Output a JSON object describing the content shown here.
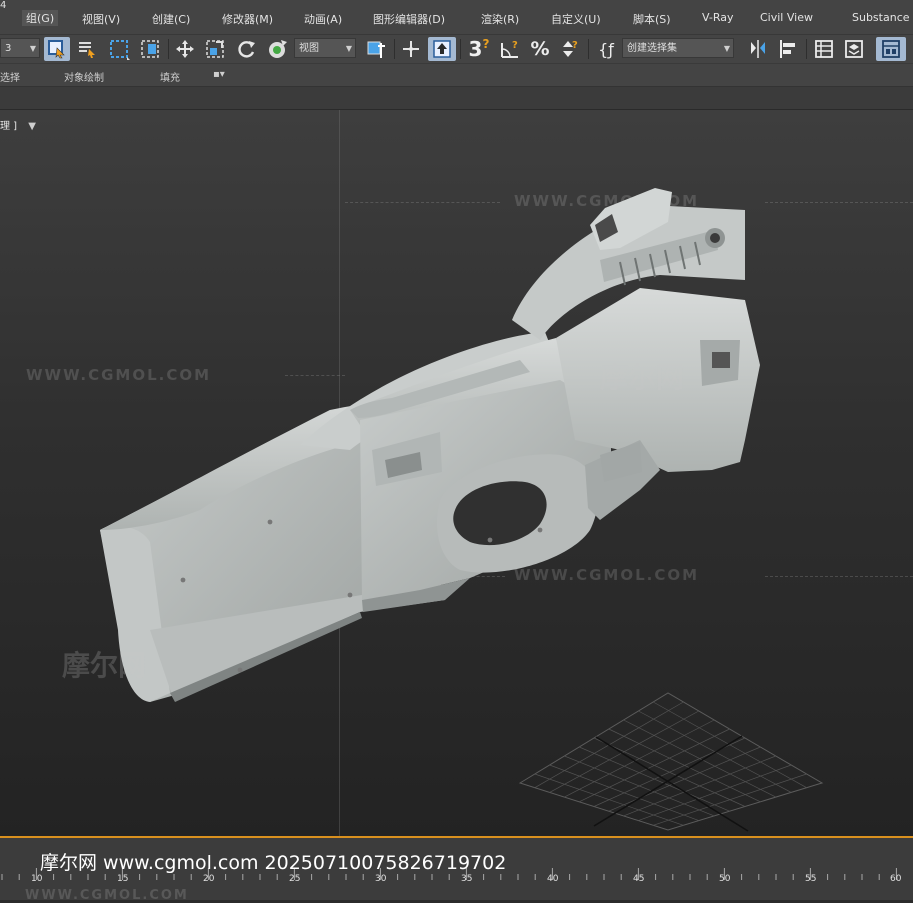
{
  "menubar": {
    "corner_glyph": "4",
    "items": [
      "组(G)",
      "视图(V)",
      "创建(C)",
      "修改器(M)",
      "动画(A)",
      "图形编辑器(D)",
      "渲染(R)",
      "自定义(U)",
      "脚本(S)",
      "V-Ray",
      "Civil View",
      "Substance"
    ]
  },
  "toolbar": {
    "selection_set_value": "3",
    "view_dropdown": "视图",
    "selection_sets_dropdown": "创建选择集",
    "snap_angle_label": "3",
    "icons": [
      "select-object-icon",
      "select-by-name-icon",
      "rect-selection-icon",
      "window-crossing-icon",
      "move-icon",
      "scale-icon",
      "rotate-icon",
      "selection-center-icon",
      "pivot-icon",
      "keyboard-shortcut-icon",
      "snap-toggle-icon",
      "angle-snap-icon",
      "percent-snap-icon",
      "spinner-snap-icon",
      "named-selection-icon",
      "mirror-icon",
      "align-icon",
      "scene-explorer-icon",
      "layer-explorer-icon",
      "ribbon-toggle-icon"
    ]
  },
  "ribbon": {
    "tab1": "选择",
    "tab2": "对象绘制",
    "tab3": "填充",
    "tab4": "▪▾"
  },
  "viewport": {
    "label": "理 ]",
    "filter_icon": "filter-icon",
    "watermark_text": "WWW.CGMOL.COM",
    "watermark_logo": "摩尔网",
    "model": "P90 submachine gun (clay render)"
  },
  "timeline": {
    "caption": "摩尔网 www.cgmol.com 20250710075826719702",
    "tick_labels": [
      "10",
      "15",
      "20",
      "25",
      "30",
      "35",
      "40",
      "45",
      "50",
      "55",
      "60"
    ],
    "bottom_watermark": "WWW.CGMOL.COM"
  },
  "colors": {
    "ui_bg": "#444444",
    "viewport_bg": "#2f2f2f",
    "accent_active": "#d9901e",
    "pressed_blue": "#5a7fa6"
  }
}
